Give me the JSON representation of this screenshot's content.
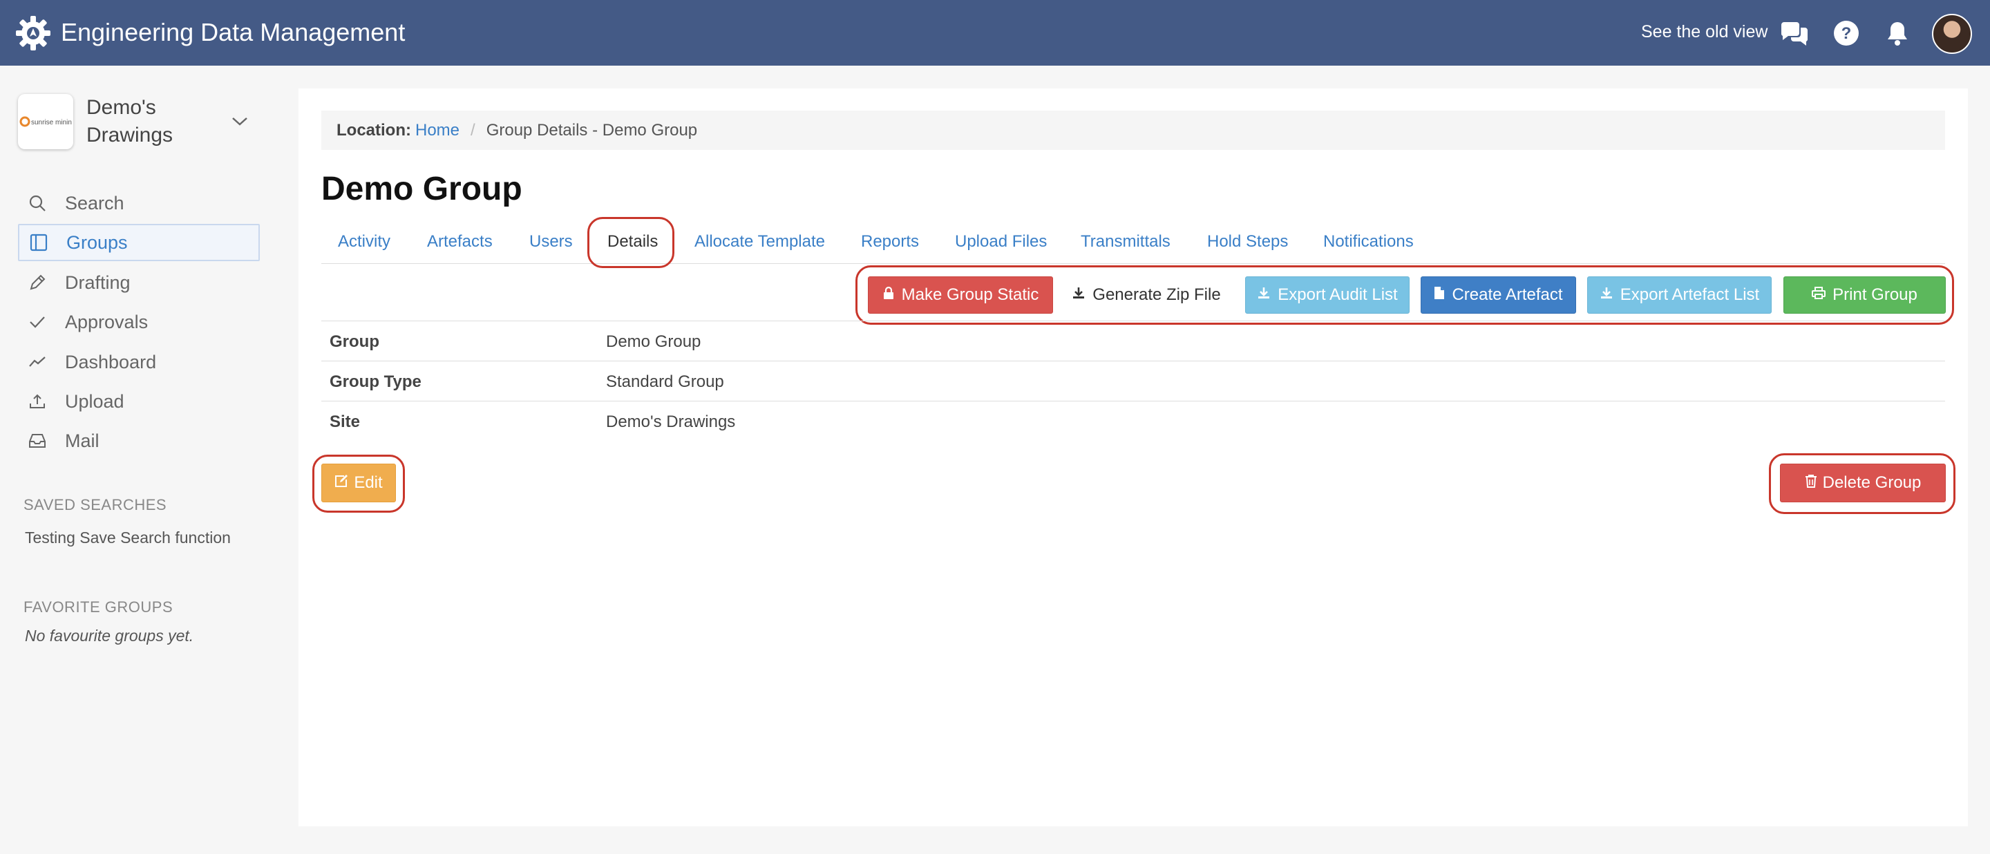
{
  "app": {
    "title": "Engineering Data Management"
  },
  "header": {
    "old_view": "See the old view"
  },
  "site": {
    "name": "Demo's Drawings",
    "logo_text": "sunrise mining"
  },
  "nav": {
    "items": [
      {
        "label": "Search",
        "icon": "search-icon"
      },
      {
        "label": "Groups",
        "icon": "groups-icon"
      },
      {
        "label": "Drafting",
        "icon": "pencil-icon"
      },
      {
        "label": "Approvals",
        "icon": "check-icon"
      },
      {
        "label": "Dashboard",
        "icon": "chart-icon"
      },
      {
        "label": "Upload",
        "icon": "upload-icon"
      },
      {
        "label": "Mail",
        "icon": "inbox-icon"
      }
    ]
  },
  "saved_searches": {
    "heading": "SAVED SEARCHES",
    "items": [
      "Testing Save Search function"
    ]
  },
  "favorite_groups": {
    "heading": "FAVORITE GROUPS",
    "empty": "No favourite groups yet."
  },
  "breadcrumb": {
    "label": "Location:",
    "home": "Home",
    "current": "Group Details - Demo Group"
  },
  "page": {
    "title": "Demo Group"
  },
  "tabs": [
    "Activity",
    "Artefacts",
    "Users",
    "Details",
    "Allocate Template",
    "Reports",
    "Upload Files",
    "Transmittals",
    "Hold Steps",
    "Notifications"
  ],
  "toolbar": {
    "make_static": "Make Group Static",
    "zip": "Generate Zip File",
    "export_audit": "Export Audit List",
    "create_artefact": "Create Artefact",
    "export_artefact": "Export Artefact List",
    "print": "Print Group"
  },
  "details": [
    {
      "key": "Group",
      "value": "Demo Group"
    },
    {
      "key": "Group Type",
      "value": "Standard Group"
    },
    {
      "key": "Site",
      "value": "Demo's Drawings"
    }
  ],
  "actions": {
    "edit": "Edit",
    "delete": "Delete Group"
  },
  "colors": {
    "header": "#445a86",
    "link": "#3a7fc7",
    "danger": "#d9534f",
    "warning": "#f0ad4e",
    "info": "#79c3e4",
    "primary": "#3f7fc6",
    "success": "#5cb85c",
    "highlight": "#c9362b"
  }
}
